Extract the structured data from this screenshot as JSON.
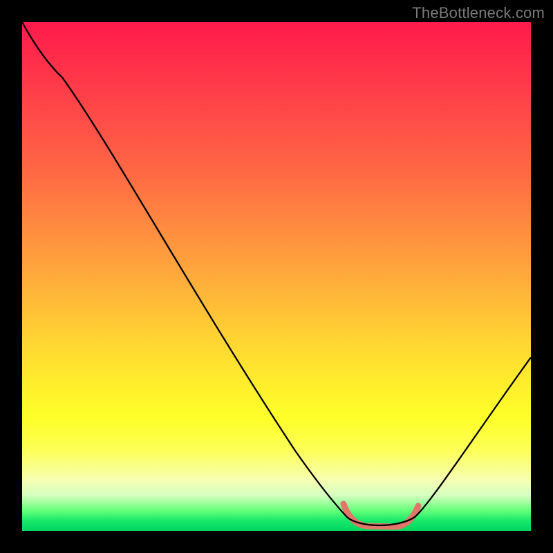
{
  "attribution": "TheBottleneck.com",
  "chart_data": {
    "type": "line",
    "title": "",
    "xlabel": "",
    "ylabel": "",
    "x": [
      0,
      5,
      10,
      15,
      20,
      25,
      30,
      35,
      40,
      45,
      50,
      55,
      60,
      63,
      66,
      70,
      73,
      76,
      80,
      84,
      88,
      92,
      96,
      100
    ],
    "values": [
      100,
      96,
      90,
      82,
      74,
      66,
      58,
      49,
      41,
      33,
      25,
      17,
      10,
      5,
      2,
      0.5,
      0.5,
      0.5,
      2,
      6,
      12,
      19,
      26,
      34
    ],
    "optimal_range": {
      "x_start": 63,
      "x_end": 76
    },
    "xlim": [
      0,
      100
    ],
    "ylim": [
      0,
      100
    ],
    "background": "vertical rainbow gradient (red at top → green at bottom)"
  }
}
